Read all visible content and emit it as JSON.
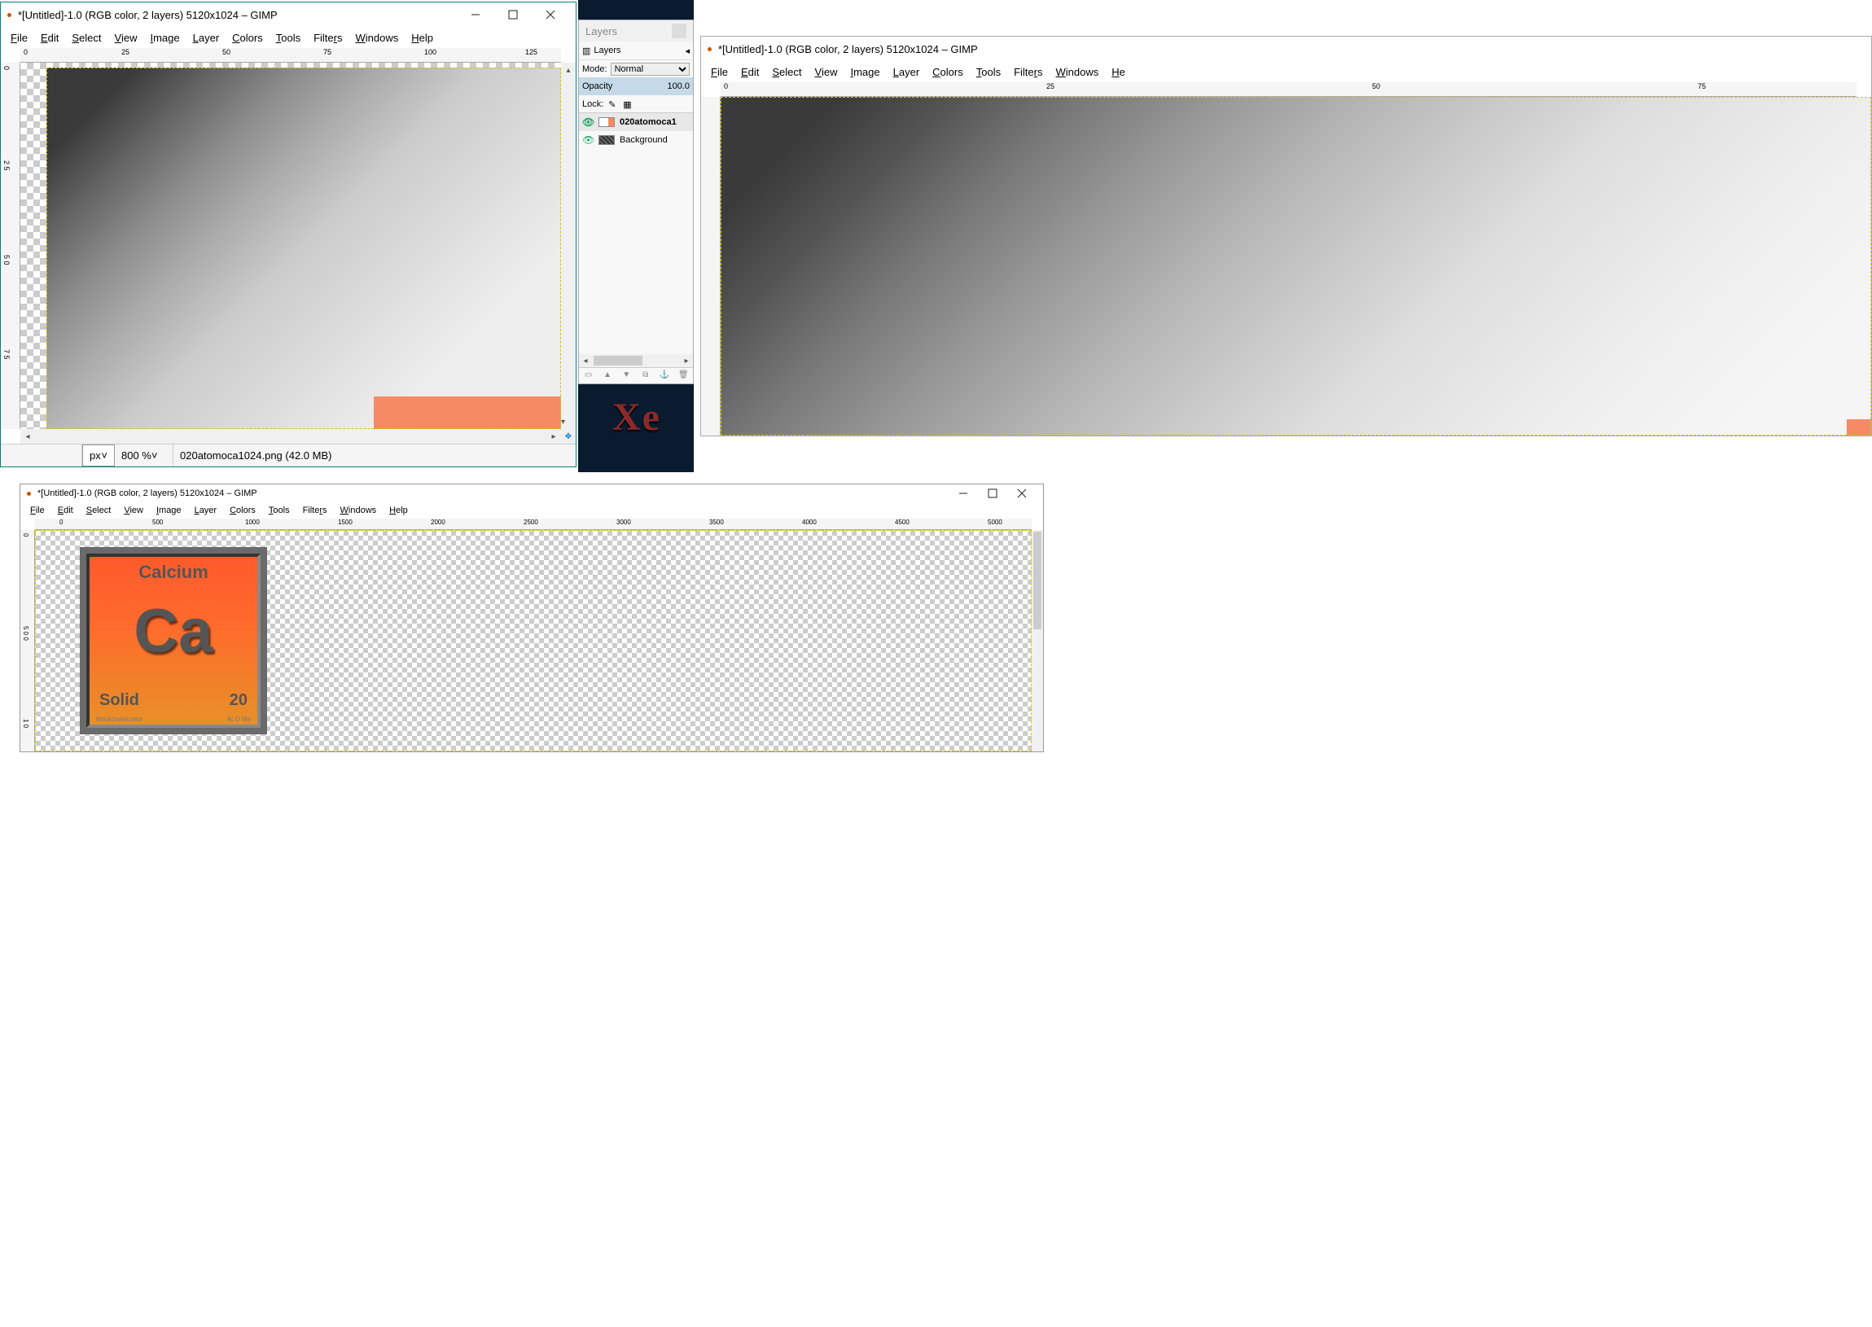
{
  "common": {
    "title": "*[Untitled]-1.0 (RGB color, 2 layers) 5120x1024 – GIMP",
    "menus": [
      "File",
      "Edit",
      "Select",
      "View",
      "Image",
      "Layer",
      "Colors",
      "Tools",
      "Filters",
      "Windows",
      "Help"
    ],
    "ruler_h1": [
      "0",
      "25",
      "50",
      "75",
      "100",
      "125"
    ],
    "ruler_v1": [
      "0",
      "2 5",
      "5 0",
      "7 5"
    ],
    "ruler_h2": [
      "0",
      "25",
      "50",
      "75"
    ],
    "ruler_h3": [
      "0",
      "500",
      "1000",
      "1500",
      "2000",
      "2500",
      "3000",
      "3500",
      "4000",
      "4500",
      "5000"
    ],
    "ruler_v3": [
      "0",
      "5 0 0",
      "1 0"
    ]
  },
  "win1_status": {
    "unit": "px",
    "zoom": "800 %",
    "file": "020atomoca1024.png (42.0 MB)"
  },
  "layers": {
    "title": "Layers",
    "tab": "Layers",
    "mode_label": "Mode:",
    "mode_value": "Normal",
    "opacity_label": "Opacity",
    "opacity_value": "100.0",
    "lock_label": "Lock:",
    "items": [
      {
        "name": "020atomoca1",
        "active": true,
        "thumb": "orange"
      },
      {
        "name": "Background",
        "active": false,
        "thumb": "bg"
      }
    ]
  },
  "xe": "Xe",
  "tile": {
    "name": "Calcium",
    "symbol": "Ca",
    "state": "Solid",
    "number": "20",
    "foot1": "blockchainizator",
    "foot2": "At O Me"
  }
}
